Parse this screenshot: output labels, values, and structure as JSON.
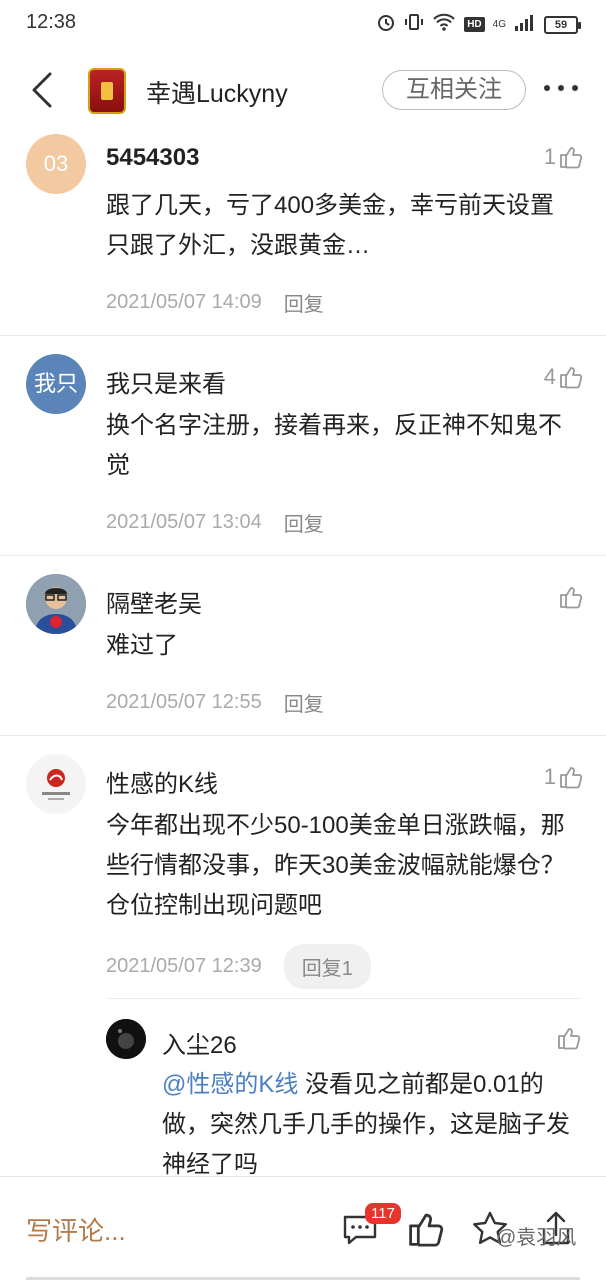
{
  "status_bar": {
    "time": "12:38",
    "hd": "HD",
    "network": "4G",
    "battery": "59"
  },
  "header": {
    "username": "幸遇Luckyny",
    "follow_label": "互相关注"
  },
  "comments": [
    {
      "avatar_text": "03",
      "avatar_color": "#f2c9a0",
      "username": "5454303",
      "likes": "1",
      "text": "跟了几天，亏了400多美金，幸亏前天设置只跟了外汇，没跟黄金…",
      "time": "2021/05/07 14:09",
      "reply": "回复"
    },
    {
      "avatar_text": "我只",
      "avatar_color": "#5b84b9",
      "username": "我只是来看",
      "likes": "4",
      "text": "换个名字注册，接着再来，反正神不知鬼不觉",
      "time": "2021/05/07 13:04",
      "reply": "回复"
    },
    {
      "avatar_text": "",
      "avatar_color": "#7a8a99",
      "username": "隔壁老吴",
      "likes": "",
      "text": "难过了",
      "time": "2021/05/07 12:55",
      "reply": "回复"
    },
    {
      "avatar_text": "",
      "avatar_color": "#f4f4f4",
      "username": "性感的K线",
      "likes": "1",
      "text": "今年都出现不少50-100美金单日涨跌幅，那些行情都没事，昨天30美金波幅就能爆仓？仓位控制出现问题吧",
      "time": "2021/05/07 12:39",
      "reply": "回复1"
    }
  ],
  "sub_reply": {
    "username": "入尘26",
    "mention": "@性感的K线",
    "text": " 没看见之前都是0.01的做，突然几手几手的操作，这是脑子发神经了吗"
  },
  "bottom_bar": {
    "write_label": "写评论...",
    "comment_count": "117",
    "watermark": "@袁羽风"
  }
}
